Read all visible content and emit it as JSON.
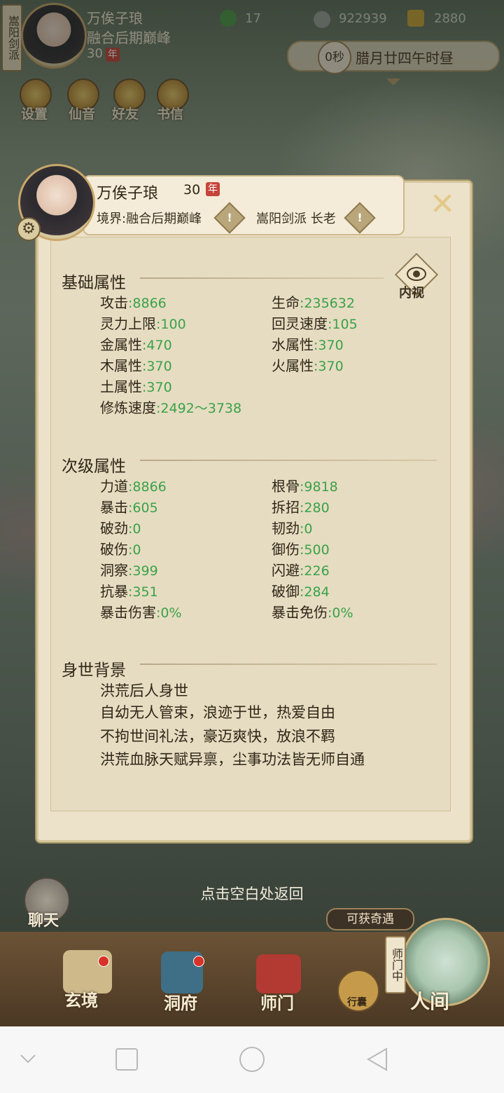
{
  "top": {
    "sect_tab": "嵩阳剑派",
    "name": "万俟子琅",
    "realm": "融合后期巅峰",
    "age": "30",
    "age_unit": "年",
    "res1": "17",
    "res2": "922939",
    "res3": "2880",
    "time_seconds": "0秒",
    "date": "腊月廿四午时昼",
    "menu": [
      "设置",
      "仙音",
      "好友",
      "书信"
    ]
  },
  "card": {
    "name": "万俟子琅",
    "age": "30",
    "age_unit": "年",
    "realm": "境界:融合后期巅峰",
    "sect": "嵩阳剑派 长老",
    "warn": "!",
    "neishi": "内视"
  },
  "basic": {
    "title": "基础属性",
    "stats": [
      {
        "label": "攻击",
        "value": ":8866"
      },
      {
        "label": "生命",
        "value": ":235632"
      },
      {
        "label": "灵力上限",
        "value": ":100"
      },
      {
        "label": "回灵速度",
        "value": ":105"
      },
      {
        "label": "金属性",
        "value": ":470"
      },
      {
        "label": "水属性",
        "value": ":370"
      },
      {
        "label": "木属性",
        "value": ":370"
      },
      {
        "label": "火属性",
        "value": ":370"
      },
      {
        "label": "土属性",
        "value": ":370"
      },
      {
        "label": "修炼速度",
        "value": ":2492～3738"
      }
    ]
  },
  "secondary": {
    "title": "次级属性",
    "stats": [
      {
        "label": "力道",
        "value": ":8866"
      },
      {
        "label": "根骨",
        "value": ":9818"
      },
      {
        "label": "暴击",
        "value": ":605"
      },
      {
        "label": "拆招",
        "value": ":280"
      },
      {
        "label": "破劲",
        "value": ":0"
      },
      {
        "label": "韧劲",
        "value": ":0"
      },
      {
        "label": "破伤",
        "value": ":0"
      },
      {
        "label": "御伤",
        "value": ":500"
      },
      {
        "label": "洞察",
        "value": ":399"
      },
      {
        "label": "闪避",
        "value": ":226"
      },
      {
        "label": "抗暴",
        "value": ":351"
      },
      {
        "label": "破御",
        "value": ":284"
      },
      {
        "label": "暴击伤害",
        "value": ":0%"
      },
      {
        "label": "暴击免伤",
        "value": ":0%"
      }
    ]
  },
  "background": {
    "title": "身世背景",
    "lines": [
      "洪荒后人身世",
      "自幼无人管束，浪迹于世，热爱自由",
      "不拘世间礼法，豪迈爽快，放浪不羁",
      "洪荒血脉天赋异禀，尘事功法皆无师自通"
    ]
  },
  "hint": "点击空白处返回",
  "chat": "聊天",
  "ribbon": "可获奇遇",
  "nav": [
    "玄境",
    "洞府",
    "师门",
    "行囊",
    "人间"
  ],
  "world_tag": "师门中",
  "colors": {
    "stat_value": "#3aa24a",
    "badge": "#c6443a",
    "panel": "#ece2c9"
  }
}
